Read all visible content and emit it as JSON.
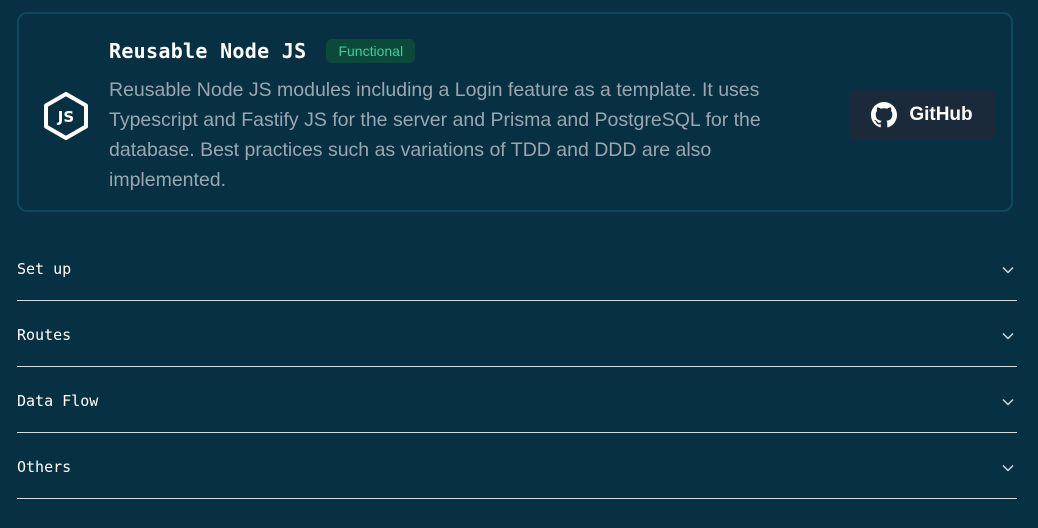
{
  "project": {
    "title": "Reusable Node JS",
    "badge": "Functional",
    "description": "Reusable Node JS modules including a Login feature as a template. It uses Typescript and Fastify JS for the server and Prisma and PostgreSQL for the database. Best practices such as variations of TDD and DDD are also implemented.",
    "logo_icon": "nodejs-icon",
    "github_label": "GitHub",
    "github_icon": "github-icon"
  },
  "sections": [
    {
      "label": "Set up"
    },
    {
      "label": "Routes"
    },
    {
      "label": "Data Flow"
    },
    {
      "label": "Others"
    }
  ],
  "colors": {
    "background": "#073142",
    "badge_bg": "#0b4a3a",
    "badge_text": "#34d399",
    "button_bg": "#1a2a3a"
  }
}
